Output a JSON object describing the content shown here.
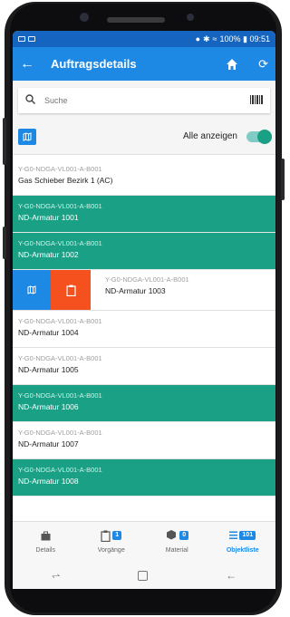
{
  "status_bar": {
    "right_text": "100% ▮ 09:51"
  },
  "app_bar": {
    "title": "Auftragsdetails"
  },
  "search": {
    "placeholder": "Suche"
  },
  "filter": {
    "show_all_label": "Alle anzeigen",
    "show_all_on": true
  },
  "list": {
    "items": [
      {
        "code": "Y-G0-NDGA-VL001-A-B001",
        "name": "Gas Schieber Bezirk 1 (AC)",
        "highlighted": false
      },
      {
        "code": "Y-G0-NDGA-VL001-A-B001",
        "name": "ND-Armatur 1001",
        "highlighted": true
      },
      {
        "code": "Y-G0-NDGA-VL001-A-B001",
        "name": "ND-Armatur 1002",
        "highlighted": true
      },
      {
        "code": "Y-G0-NDGA-VL001-A-B001",
        "name": "ND-Armatur 1003",
        "highlighted": false,
        "swiped": true
      },
      {
        "code": "Y-G0-NDGA-VL001-A-B001",
        "name": "ND-Armatur 1004",
        "highlighted": false
      },
      {
        "code": "Y-G0-NDGA-VL001-A-B001",
        "name": "ND-Armatur 1005",
        "highlighted": false
      },
      {
        "code": "Y-G0-NDGA-VL001-A-B001",
        "name": "ND-Armatur 1006",
        "highlighted": true
      },
      {
        "code": "Y-G0-NDGA-VL001-A-B001",
        "name": "ND-Armatur 1007",
        "highlighted": false
      },
      {
        "code": "Y-G0-NDGA-VL001-A-B001",
        "name": "ND-Armatur 1008",
        "highlighted": true
      }
    ]
  },
  "bottom_nav": {
    "tabs": [
      {
        "label": "Details",
        "icon": "briefcase-icon",
        "badge": ""
      },
      {
        "label": "Vorgänge",
        "icon": "clipboard-icon",
        "badge": "1"
      },
      {
        "label": "Material",
        "icon": "cubes-icon",
        "badge": "0"
      },
      {
        "label": "Objektliste",
        "icon": "list-icon",
        "badge": "101"
      }
    ],
    "active": "Objektliste"
  },
  "colors": {
    "primary": "#1e88e5",
    "accent": "#1aa085",
    "danger": "#f4511e"
  }
}
